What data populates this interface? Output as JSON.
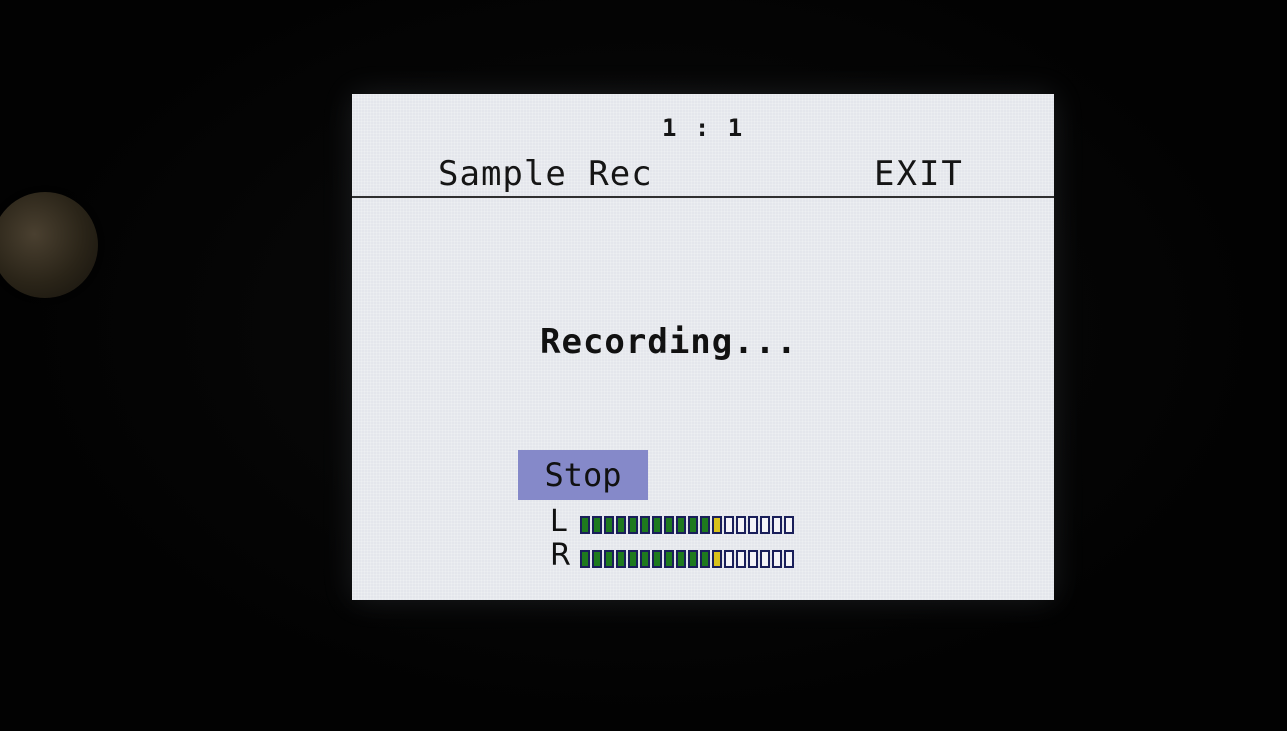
{
  "header": {
    "counter": "1 :  1",
    "title": "Sample Rec",
    "exit_label": "EXIT"
  },
  "main": {
    "status_text": "Recording...",
    "stop_label": "Stop"
  },
  "meters": [
    {
      "label": "L",
      "segments_total": 18,
      "segments_lit": 12,
      "level_fraction": 0.667
    },
    {
      "label": "R",
      "segments_total": 18,
      "segments_lit": 12,
      "level_fraction": 0.667
    }
  ],
  "colors": {
    "meter_on": "#1e7a1e",
    "meter_peak": "#d8c21a",
    "stop_button_bg": "#8589c9",
    "screen_bg": "#e4e6ec"
  }
}
